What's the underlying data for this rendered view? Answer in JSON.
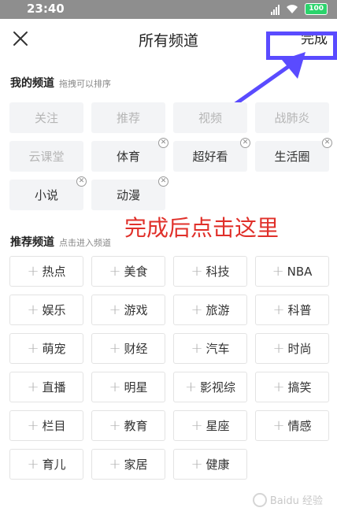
{
  "status": {
    "time": "23:40",
    "battery": "100"
  },
  "header": {
    "title": "所有频道",
    "done_label": "完成"
  },
  "my_channels": {
    "title": "我的频道",
    "hint": "拖拽可以排序",
    "items": [
      {
        "label": "关注",
        "fixed": true,
        "removable": false
      },
      {
        "label": "推荐",
        "fixed": true,
        "removable": false
      },
      {
        "label": "视频",
        "fixed": true,
        "removable": false
      },
      {
        "label": "战肺炎",
        "fixed": true,
        "removable": false
      },
      {
        "label": "云课堂",
        "fixed": true,
        "removable": false
      },
      {
        "label": "体育",
        "fixed": false,
        "removable": true
      },
      {
        "label": "超好看",
        "fixed": false,
        "removable": true
      },
      {
        "label": "生活圈",
        "fixed": false,
        "removable": true
      },
      {
        "label": "小说",
        "fixed": false,
        "removable": true
      },
      {
        "label": "动漫",
        "fixed": false,
        "removable": true
      }
    ]
  },
  "recommended": {
    "title": "推荐频道",
    "hint": "点击进入频道",
    "items": [
      "热点",
      "美食",
      "科技",
      "NBA",
      "娱乐",
      "游戏",
      "旅游",
      "科普",
      "萌宠",
      "财经",
      "汽车",
      "时尚",
      "直播",
      "明星",
      "影视综",
      "搞笑",
      "栏目",
      "教育",
      "星座",
      "情感",
      "育儿",
      "家居",
      "健康"
    ]
  },
  "annotation": {
    "text": "完成后点击这里"
  },
  "watermark": {
    "text": "Baidu 经验"
  },
  "colors": {
    "highlight": "#5a4bff",
    "annotation": "#e0302a"
  }
}
